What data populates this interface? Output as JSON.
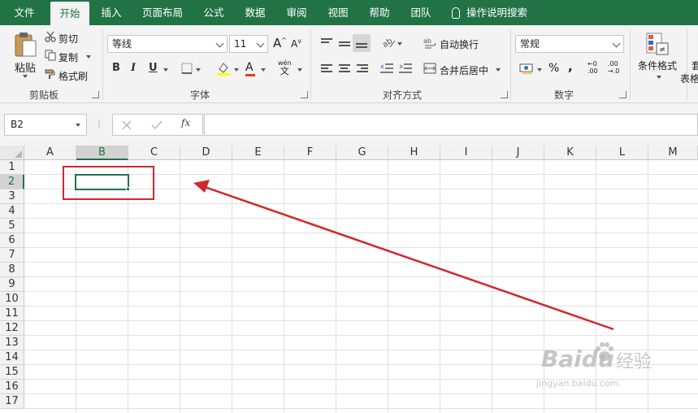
{
  "tabs": [
    "文件",
    "开始",
    "插入",
    "页面布局",
    "公式",
    "数据",
    "审阅",
    "视图",
    "帮助",
    "团队",
    "操作说明搜索"
  ],
  "active_tab": "开始",
  "clipboard": {
    "paste_label": "粘贴",
    "cut_label": "剪切",
    "copy_label": "复制",
    "format_painter_label": "格式刷",
    "group_label": "剪贴板"
  },
  "font": {
    "font_name": "等线",
    "font_size": "11",
    "bold": "B",
    "italic": "I",
    "underline": "U",
    "pinyin_top": "wén",
    "pinyin_bottom": "文",
    "font_color_letter": "A",
    "grow_letter": "A",
    "shrink_letter": "A",
    "group_label": "字体"
  },
  "alignment": {
    "wrap_text_label": "自动换行",
    "merge_center_label": "合并后居中",
    "group_label": "对齐方式"
  },
  "number": {
    "format_value": "常规",
    "percent": "%",
    "comma": ",",
    "dec_increase_top": "←0",
    "dec_increase_bottom": ".00",
    "dec_decrease_top": ".00",
    "dec_decrease_bottom": "→.0",
    "group_label": "数字"
  },
  "styles": {
    "conditional_format_label": "条件格式",
    "table_format_label_a": "表格",
    "table_format_label_b": "套"
  },
  "formula_bar": {
    "name_box": "B2",
    "fx_label": "fx",
    "formula": ""
  },
  "columns": [
    "A",
    "B",
    "C",
    "D",
    "E",
    "F",
    "G",
    "H",
    "I",
    "J",
    "K",
    "L",
    "M"
  ],
  "rows": [
    "1",
    "2",
    "3",
    "4",
    "5",
    "6",
    "7",
    "8",
    "9",
    "10",
    "11",
    "12",
    "13",
    "14",
    "15",
    "16",
    "17"
  ],
  "selected_cell": "B2",
  "watermark": {
    "brand": "Baidu",
    "brand_cn": "经验",
    "url": "jingyan.baidu.com"
  },
  "colors": {
    "excel_green": "#217346",
    "annotation_red": "#d0282c"
  }
}
